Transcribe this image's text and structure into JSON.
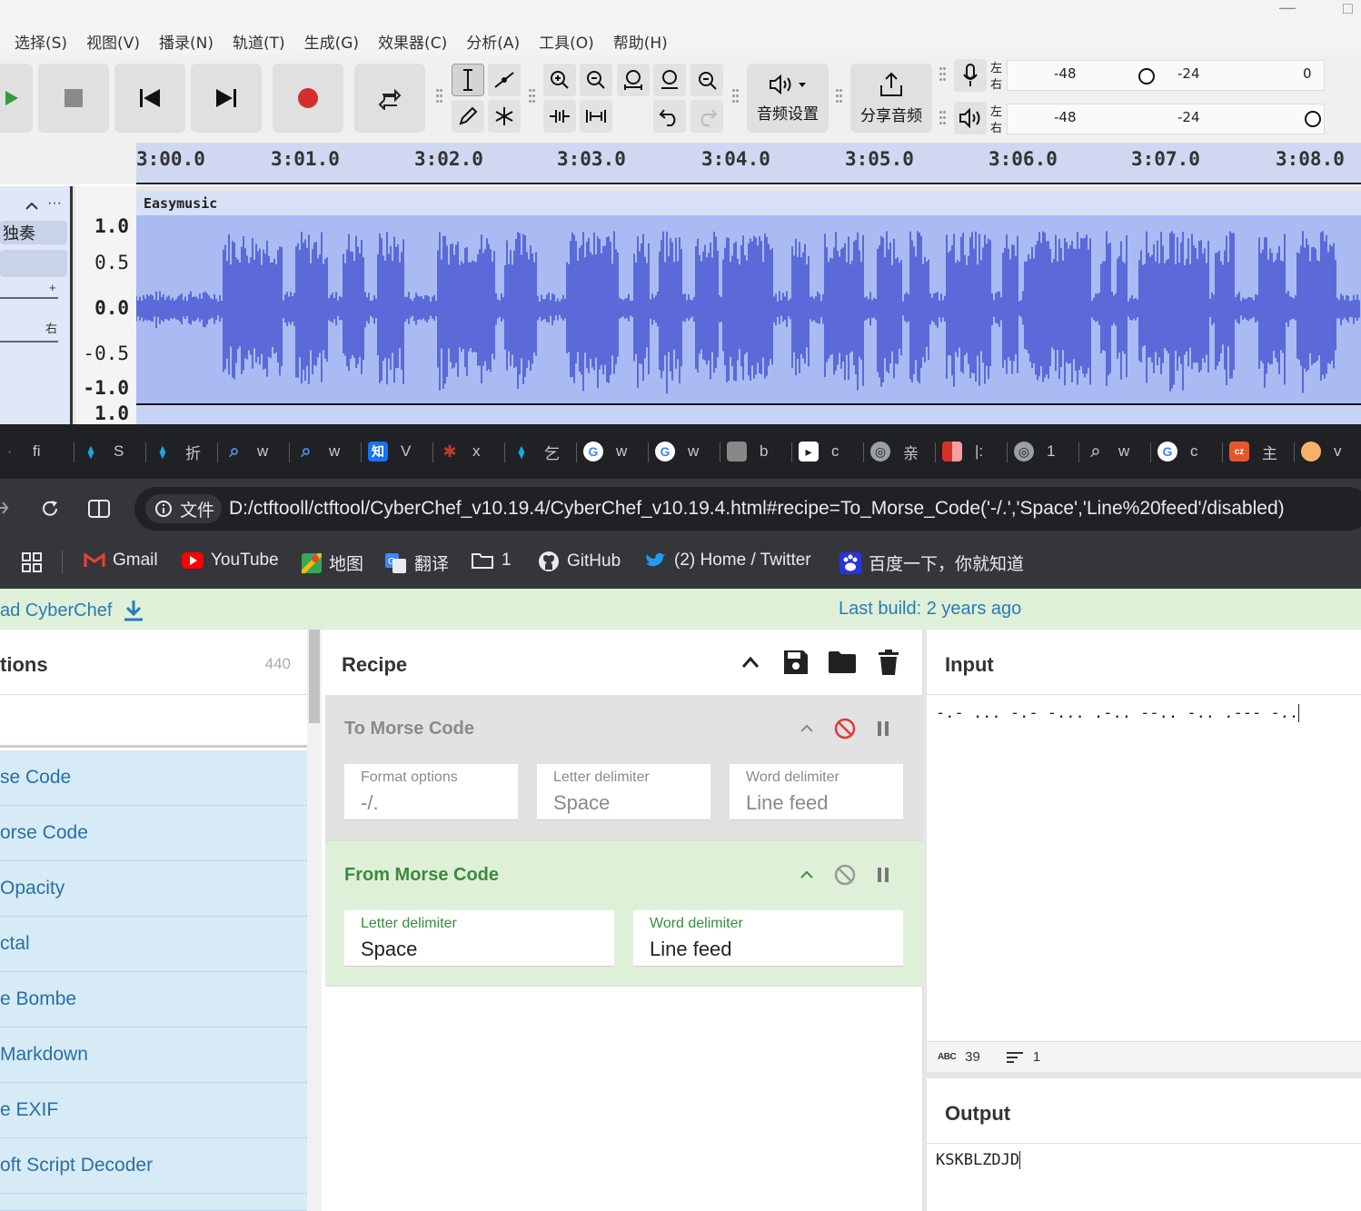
{
  "audacity": {
    "menu": [
      "选择(S)",
      "视图(V)",
      "播录(N)",
      "轨道(T)",
      "生成(G)",
      "效果器(C)",
      "分析(A)",
      "工具(O)",
      "帮助(H)"
    ],
    "audio_setup_label": "音频设置",
    "share_audio_label": "分享音频",
    "meter_labels": {
      "left": "左",
      "right": "右",
      "db48": "-48",
      "db24": "-24",
      "db0": "0"
    },
    "timeline_ticks": [
      "3:00.0",
      "3:01.0",
      "3:02.0",
      "3:03.0",
      "3:04.0",
      "3:05.0",
      "3:06.0",
      "3:07.0",
      "3:08.0"
    ],
    "track": {
      "solo_label": "独奏",
      "plus": "+",
      "pan_right": "右",
      "clip_name": "Easymusic"
    },
    "vertical_scale": [
      "1.0",
      "0.5",
      "0.0",
      "-0.5",
      "-1.0",
      "1.0"
    ]
  },
  "browser": {
    "tabs": [
      {
        "icon": "tab-icon",
        "label": "fi",
        "color": "#5f6368"
      },
      {
        "icon": "drop-icon",
        "label": "S",
        "color": "#1ea7d8"
      },
      {
        "icon": "drop-icon",
        "label": "折",
        "color": "#1ea7d8"
      },
      {
        "icon": "search-icon",
        "label": "w",
        "color": "#4a90e2"
      },
      {
        "icon": "search-icon",
        "label": "w",
        "color": "#4a90e2"
      },
      {
        "icon": "zhihu-icon",
        "label": "V",
        "color": "#1772f6"
      },
      {
        "icon": "bug-icon",
        "label": "x",
        "color": "#c0392b"
      },
      {
        "icon": "drop-icon",
        "label": "乞",
        "color": "#1ea7d8"
      },
      {
        "icon": "google-icon",
        "label": "w",
        "color": "#ffffff"
      },
      {
        "icon": "google-icon",
        "label": "w",
        "color": "#ffffff"
      },
      {
        "icon": "image-icon",
        "label": "b",
        "color": "#888888"
      },
      {
        "icon": "doc-icon",
        "label": "c",
        "color": "#ffffff"
      },
      {
        "icon": "chrome-icon",
        "label": "亲",
        "color": "#9aa0a6"
      },
      {
        "icon": "flag-icon",
        "label": "|:",
        "color": "#d93025"
      },
      {
        "icon": "globe-icon",
        "label": "1",
        "color": "#9aa0a6"
      },
      {
        "icon": "search-icon",
        "label": "w",
        "color": "#9aa0a6"
      },
      {
        "icon": "google-icon",
        "label": "c",
        "color": "#ffffff"
      },
      {
        "icon": "cz-icon",
        "label": "主",
        "color": "#e4572e"
      },
      {
        "icon": "avatar-icon",
        "label": "v",
        "color": "#f6b26b"
      }
    ],
    "security_badge": "文件",
    "url": "D:/ctftooll/ctftool/CyberChef_v10.19.4/CyberChef_v10.19.4.html#recipe=To_Morse_Code('-/.','Space','Line%20feed'/disabled)",
    "bookmarks": [
      "Gmail",
      "YouTube",
      "地图",
      "翻译",
      "1",
      "GitHub",
      "(2) Home / Twitter",
      "百度一下，你就知道"
    ]
  },
  "cyberchef": {
    "download_text": "ad CyberChef",
    "last_build": "Last build: 2 years ago",
    "operations": {
      "title": "tions",
      "count": "440",
      "items": [
        "se Code",
        "orse Code",
        "Opacity",
        "ctal",
        "e Bombe",
        "Markdown",
        "e EXIF",
        "oft Script Decoder"
      ]
    },
    "recipe": {
      "title": "Recipe",
      "ops": [
        {
          "name": "To Morse Code",
          "disabled": true,
          "fields": [
            {
              "label": "Format options",
              "value": "-/."
            },
            {
              "label": "Letter delimiter",
              "value": "Space"
            },
            {
              "label": "Word delimiter",
              "value": "Line feed"
            }
          ]
        },
        {
          "name": "From Morse Code",
          "disabled": false,
          "fields": [
            {
              "label": "Letter delimiter",
              "value": "Space"
            },
            {
              "label": "Word delimiter",
              "value": "Line feed"
            }
          ]
        }
      ]
    },
    "input": {
      "title": "Input",
      "text": "-.- ... -.- -... .-.. --.. -.. .--- -..",
      "char_count": "39",
      "line_count": "1",
      "abc_label": "ABC"
    },
    "output": {
      "title": "Output",
      "text": "KSKBLZDJD"
    }
  },
  "colors": {
    "waveform": "#5b6ad8",
    "accent_blue": "#2a7ab8",
    "green_op": "#3b8a3e",
    "disabled_red": "#e53935"
  }
}
